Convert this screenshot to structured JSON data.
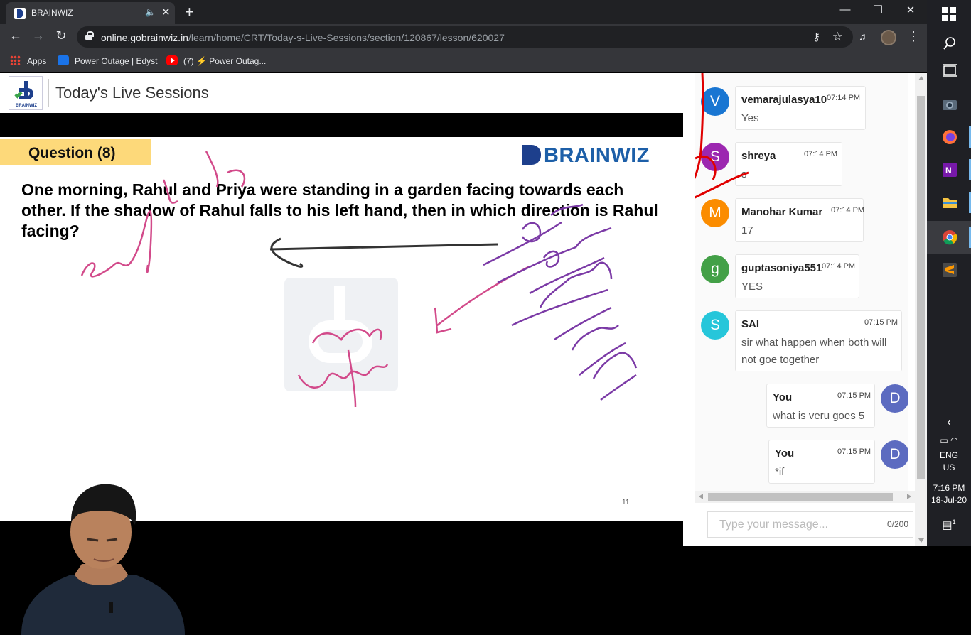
{
  "browser": {
    "tab_title": "BRAINWIZ",
    "tab_close": "✕",
    "new_tab": "+",
    "url_host": "online.gobrainwiz.in",
    "url_path": "/learn/home/CRT/Today-s-Live-Sessions/section/120867/lesson/620027",
    "bookmarks": [
      {
        "label": "Apps",
        "icon": "apps-grid-icon"
      },
      {
        "label": "Power Outage | Edyst",
        "icon": "edyst-icon"
      },
      {
        "label": "(7) ⚡ Power Outag...",
        "icon": "youtube-icon"
      }
    ],
    "window_controls": {
      "minimize": "—",
      "restore": "❐",
      "close": "✕"
    }
  },
  "page": {
    "logo_text": "BRAINWIZ",
    "title": "Today's Live Sessions"
  },
  "slide": {
    "question_label": "Question (8)",
    "brand": "BRAINWIZ",
    "question_text": "One morning, Rahul and Priya were standing in a garden facing towards each other. If the shadow of Rahul falls to his left hand, then in which direction is Rahul facing?",
    "watermark_text": "BRAINWIZ",
    "slide_number": "11",
    "annotations": [
      "straight after",
      "cross length",
      "① Sh",
      "② cross",
      "Shadow",
      "clock",
      "Map",
      "length"
    ]
  },
  "chat": {
    "messages": [
      {
        "initial": "V",
        "name": "vemarajulasya10",
        "time": "07:14 PM",
        "text": "Yes",
        "color": "#1976d2",
        "self": false
      },
      {
        "initial": "S",
        "name": "shreya",
        "time": "07:14 PM",
        "text": "s",
        "color": "#9c27b0",
        "self": false
      },
      {
        "initial": "M",
        "name": "Manohar Kumar",
        "time": "07:14 PM",
        "text": "17",
        "color": "#fb8c00",
        "self": false
      },
      {
        "initial": "g",
        "name": "guptasoniya551",
        "time": "07:14 PM",
        "text": "YES",
        "color": "#43a047",
        "self": false
      },
      {
        "initial": "S",
        "name": "SAI",
        "time": "07:15 PM",
        "text": "sir what happen when both will not goe together",
        "color": "#26c6da",
        "self": false
      },
      {
        "initial": "D",
        "name": "You",
        "time": "07:15 PM",
        "text": "what is veru goes 5",
        "color": "#5c6bc0",
        "self": true
      },
      {
        "initial": "D",
        "name": "You",
        "time": "07:15 PM",
        "text": "*if",
        "color": "#5c6bc0",
        "self": true
      }
    ],
    "input_placeholder": "Type your message...",
    "char_count": "0/200"
  },
  "taskbar": {
    "apps": [
      "windows-start-icon",
      "search-icon",
      "task-view-icon",
      "camera-icon",
      "firefox-icon",
      "onenote-icon",
      "file-explorer-icon",
      "chrome-icon",
      "sublime-text-icon"
    ],
    "language": "ENG",
    "region": "US",
    "time": "7:16 PM",
    "date": "18-Jul-20",
    "notification_count": "1"
  }
}
